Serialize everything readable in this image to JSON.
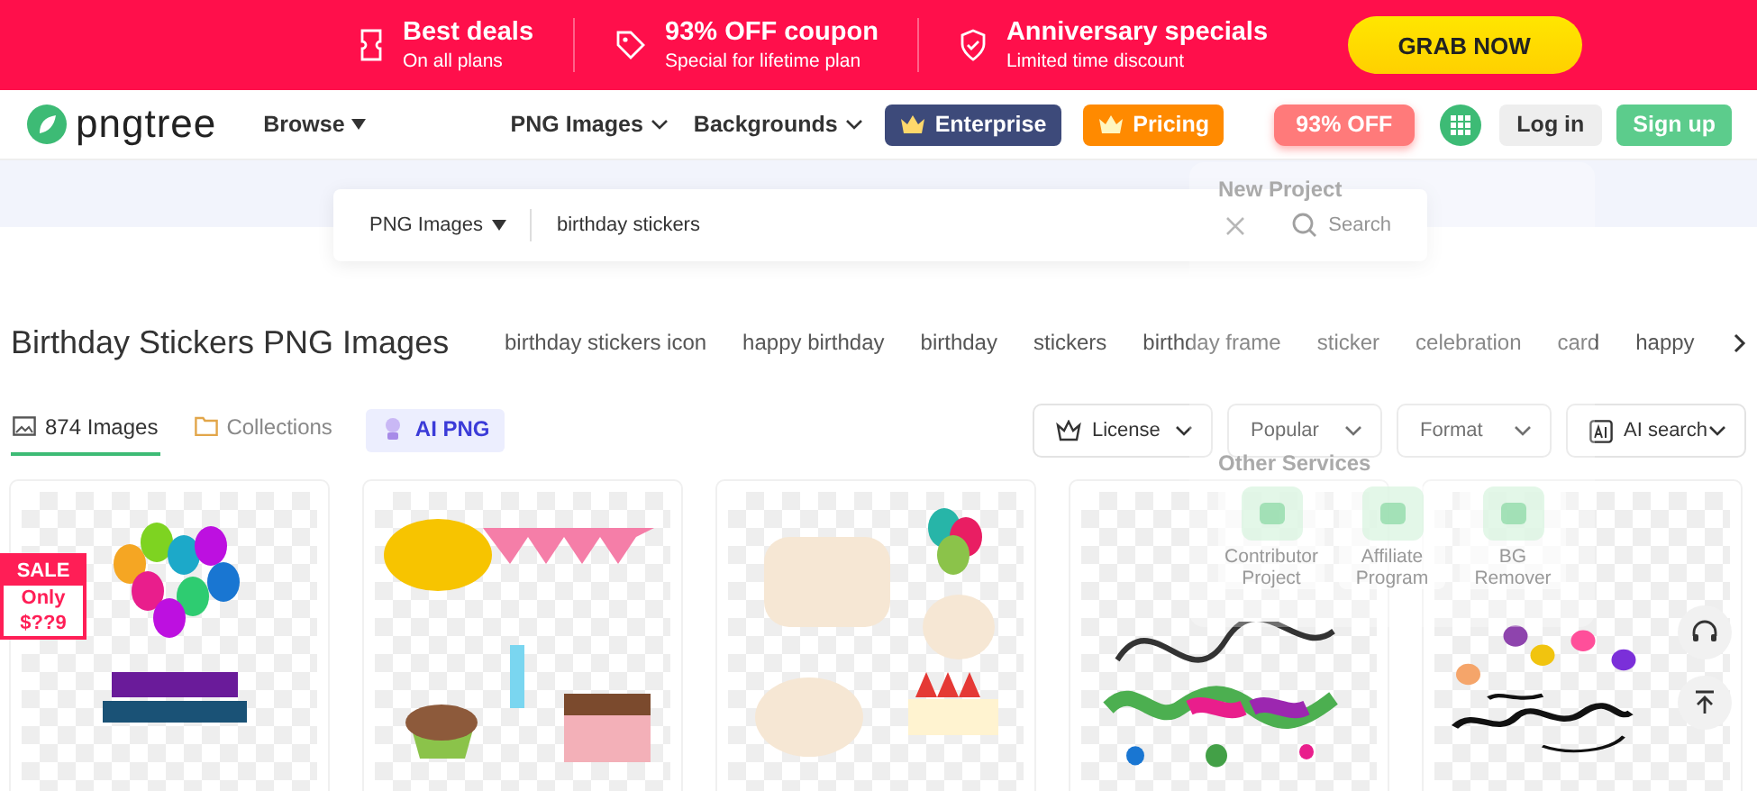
{
  "promo_banner": {
    "items": [
      {
        "kind": "deals",
        "title": "Best deals",
        "subtitle": "On all plans"
      },
      {
        "kind": "coupon",
        "title": "93% OFF coupon",
        "subtitle": "Special for lifetime plan"
      },
      {
        "kind": "anniversary",
        "title": "Anniversary specials",
        "subtitle": "Limited time discount"
      }
    ],
    "button": "GRAB NOW"
  },
  "nav": {
    "logo": "pngtree",
    "menu": [
      {
        "label": "Browse",
        "kind": "triangle"
      },
      {
        "label": "PNG Images",
        "kind": "chevron"
      },
      {
        "label": "Backgrounds",
        "kind": "chevron"
      }
    ],
    "buttons": [
      {
        "label": "Enterprise",
        "kind": "enterprise"
      },
      {
        "label": "Pricing",
        "kind": "pricing"
      },
      {
        "label": "93% OFF",
        "kind": "discount"
      },
      {
        "kind": "apps"
      },
      {
        "label": "Log in",
        "kind": "login"
      },
      {
        "label": "Sign up",
        "kind": "signup"
      }
    ]
  },
  "search": {
    "category": "PNG Images",
    "value": "birthday stickers",
    "button": "Search"
  },
  "page_title": "Birthday Stickers PNG Images",
  "related_tags": [
    "birthday stickers icon",
    "happy birthday",
    "birthday",
    "stickers",
    "birthday frame",
    "sticker",
    "celebration",
    "card",
    "happy"
  ],
  "tabs": [
    {
      "label": "874 Images",
      "kind": "images",
      "selected": true
    },
    {
      "label": "Collections",
      "kind": "collections",
      "selected": false
    },
    {
      "label": "AI PNG",
      "kind": "ai",
      "selected": false
    }
  ],
  "filters": [
    {
      "label": "License",
      "kind": "license"
    },
    {
      "label": "Popular",
      "kind": "plain"
    },
    {
      "label": "Format",
      "kind": "plain"
    },
    {
      "label": "AI search",
      "kind": "ai"
    }
  ],
  "images": [
    {
      "kind": "balloons",
      "sale": {
        "title": "SALE",
        "lines": [
          "Only",
          "$??9"
        ]
      }
    },
    {
      "kind": "party"
    },
    {
      "kind": "stickers"
    },
    {
      "kind": "script"
    },
    {
      "kind": "script-balloons"
    }
  ],
  "overlay_menu": {
    "sections": [
      {
        "title": "New Project"
      },
      {
        "title": "Other Services",
        "items": [
          {
            "label": "Contributor Project"
          },
          {
            "label": "Affiliate Program"
          },
          {
            "label": "BG Remover"
          }
        ]
      }
    ]
  }
}
